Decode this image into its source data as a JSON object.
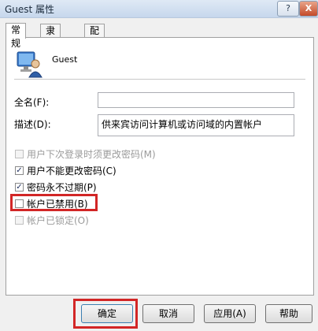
{
  "window": {
    "title": "Guest 属性",
    "help_label": "?",
    "close_label": "X"
  },
  "tabs": [
    {
      "label": "常规"
    },
    {
      "label": "隶属于"
    },
    {
      "label": "配置文件"
    }
  ],
  "general": {
    "username": "Guest",
    "fullname": {
      "label": "全名(F):",
      "value": ""
    },
    "description": {
      "label": "描述(D):",
      "value": "供来宾访问计算机或访问域的内置帐户"
    },
    "options": [
      {
        "label": "用户下次登录时须更改密码(M)",
        "checked": false,
        "enabled": false
      },
      {
        "label": "用户不能更改密码(C)",
        "checked": true,
        "enabled": true
      },
      {
        "label": "密码永不过期(P)",
        "checked": true,
        "enabled": true
      },
      {
        "label": "帐户已禁用(B)",
        "checked": false,
        "enabled": true
      },
      {
        "label": "帐户已锁定(O)",
        "checked": false,
        "enabled": false
      }
    ]
  },
  "buttons": {
    "ok": "确定",
    "cancel": "取消",
    "apply": "应用(A)",
    "help": "帮助"
  },
  "colors": {
    "highlight": "#d22626",
    "accent": "#3c7fb1"
  }
}
